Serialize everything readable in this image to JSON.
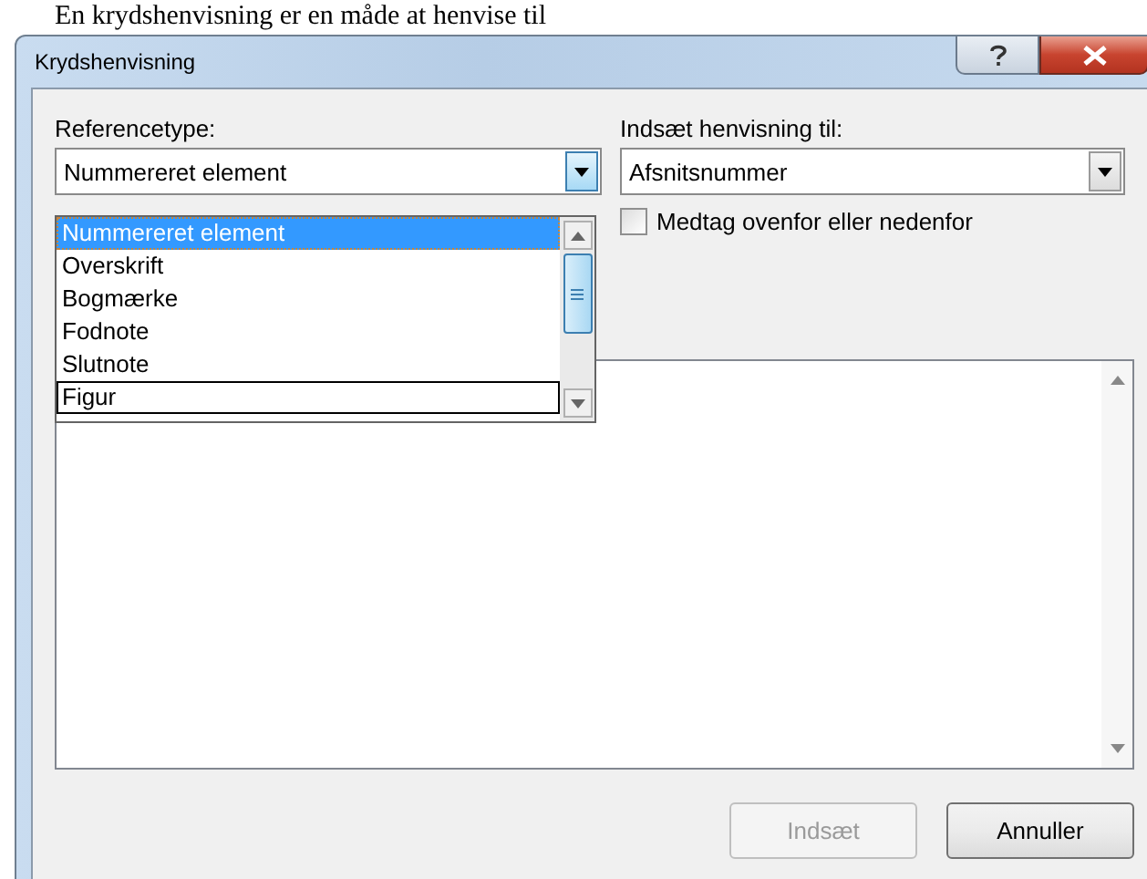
{
  "heading": "En krydshenvisning er en måde at henvise til",
  "window": {
    "title": "Krydshenvisning"
  },
  "reference_type": {
    "label": "Referencetype:",
    "value": "Nummereret element",
    "expanded": true,
    "options": [
      {
        "label": "Nummereret element",
        "selected": true,
        "focused": false
      },
      {
        "label": "Overskrift",
        "selected": false,
        "focused": false
      },
      {
        "label": "Bogmærke",
        "selected": false,
        "focused": false
      },
      {
        "label": "Fodnote",
        "selected": false,
        "focused": false
      },
      {
        "label": "Slutnote",
        "selected": false,
        "focused": false
      },
      {
        "label": "Figur",
        "selected": false,
        "focused": true
      }
    ]
  },
  "insert_reference_to": {
    "label": "Indsæt henvisning til:",
    "value": "Afsnitsnummer"
  },
  "include_above_below": {
    "label": "Medtag ovenfor eller nedenfor",
    "checked": false
  },
  "buttons": [
    {
      "label": "Indsæt",
      "disabled": true
    },
    {
      "label": "Annuller",
      "disabled": false
    }
  ]
}
